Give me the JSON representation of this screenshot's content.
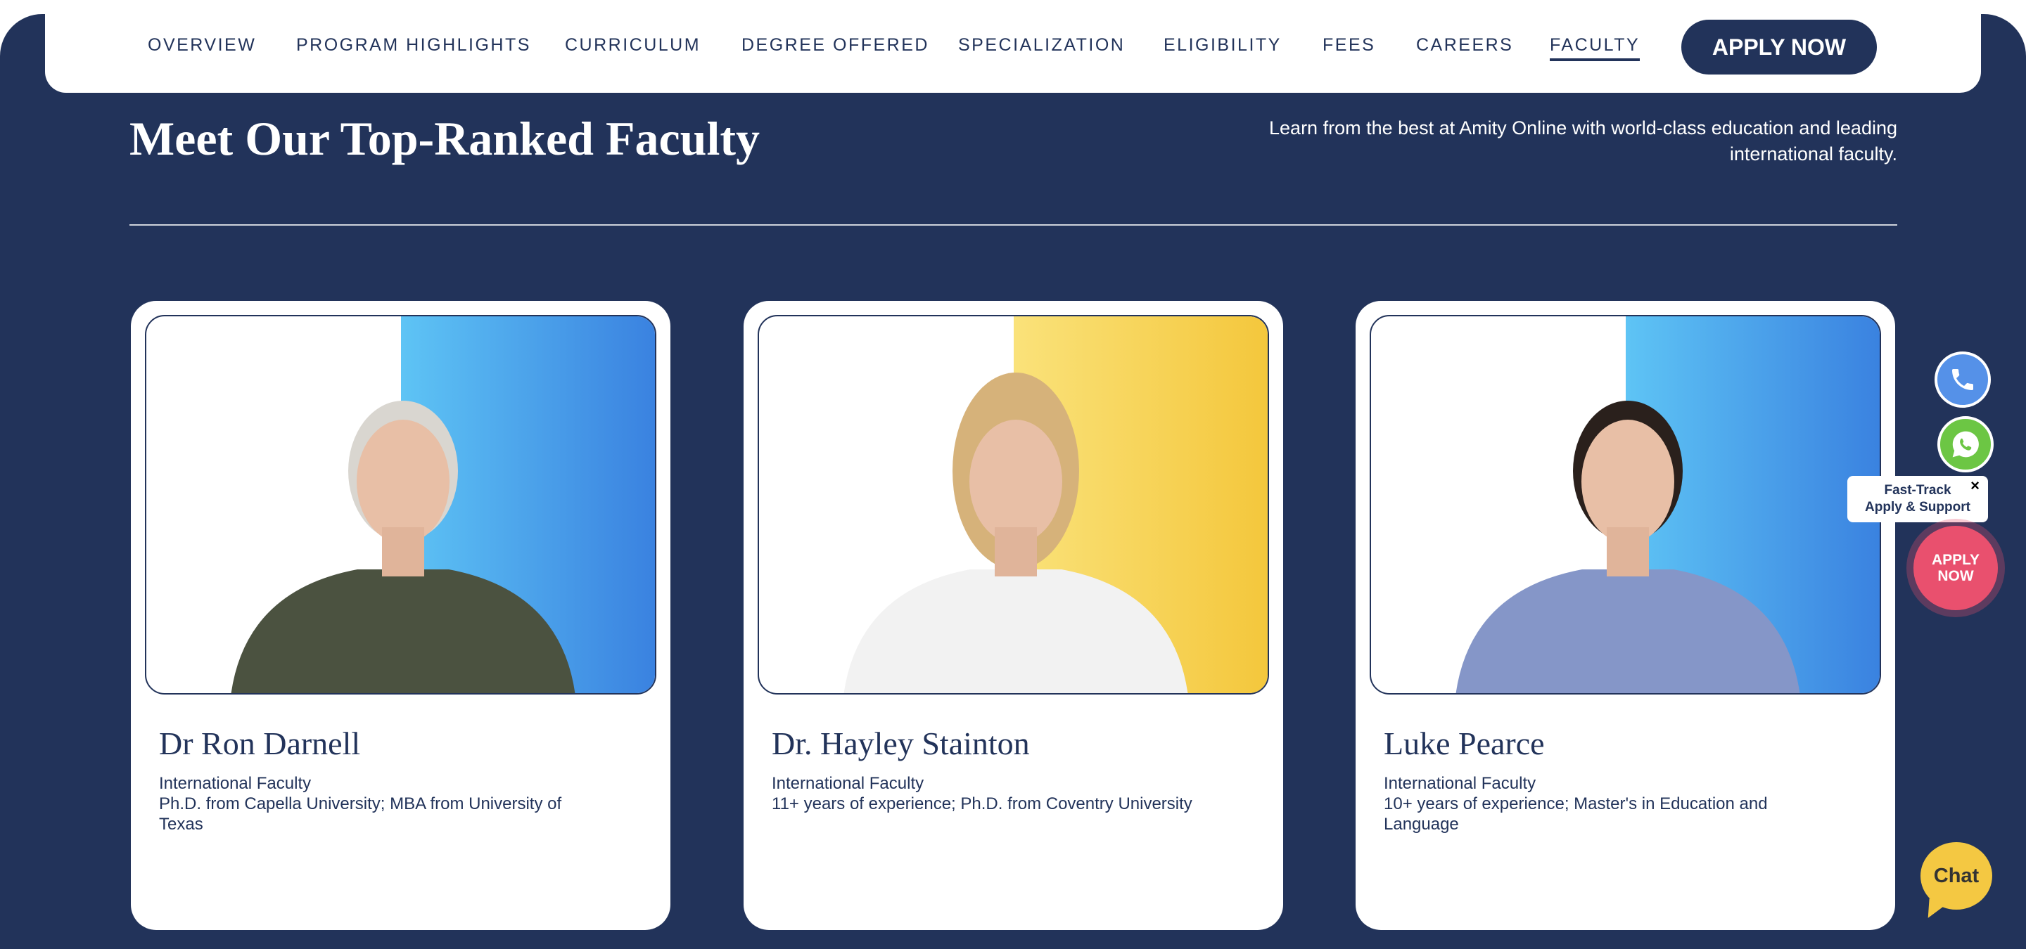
{
  "nav": {
    "items": [
      "OVERVIEW",
      "PROGRAM HIGHLIGHTS",
      "CURRICULUM",
      "DEGREE OFFERED",
      "SPECIALIZATION",
      "ELIGIBILITY",
      "FEES",
      "CAREERS",
      "FACULTY"
    ],
    "active": "FACULTY",
    "apply_label": "APPLY NOW"
  },
  "section": {
    "title": "Meet Our Top-Ranked Faculty",
    "subtitle": "Learn from the best at Amity Online with world-class education and leading international faculty."
  },
  "faculty": [
    {
      "name": "Dr Ron Darnell",
      "role": "International Faculty",
      "details": "Ph.D. from Capella University; MBA from University of Texas",
      "bg_color": "#4a9be8"
    },
    {
      "name": "Dr. Hayley Stainton",
      "role": "International Faculty",
      "details": "11+ years of experience; Ph.D. from Coventry University",
      "bg_color": "#f5cf45"
    },
    {
      "name": "Luke Pearce",
      "role": "International Faculty",
      "details": "10+ years of experience; Master's in Education and Language",
      "bg_color": "#4a9be8"
    }
  ],
  "widgets": {
    "phone_icon": "phone-icon",
    "whatsapp_icon": "whatsapp-icon",
    "popup_line1": "Fast-Track",
    "popup_line2": "Apply & Support",
    "popup_close": "×",
    "apply_line1": "APPLY",
    "apply_line2": "NOW",
    "chat_label": "Chat"
  },
  "colors": {
    "navy": "#22335a",
    "apply_pink": "#e9506e",
    "chat_yellow": "#f4c842",
    "whatsapp_green": "#6cc644",
    "phone_blue": "#5591e8"
  }
}
